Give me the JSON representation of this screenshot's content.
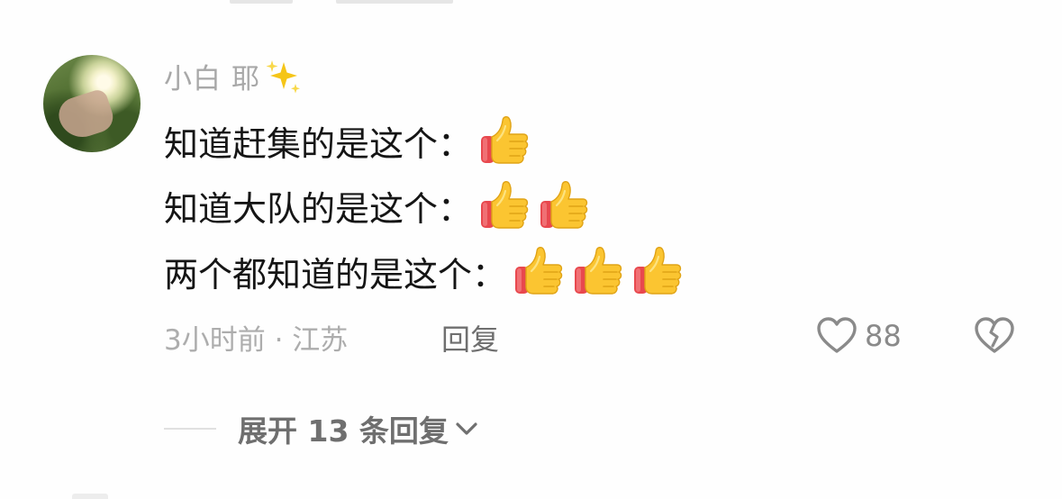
{
  "comment": {
    "username": "小白 耶",
    "username_emoji": "sparkles",
    "lines": [
      {
        "text": "知道赶集的是这个：",
        "thumbs": 1
      },
      {
        "text": "知道大队的是这个：",
        "thumbs": 2
      },
      {
        "text": "两个都知道的是这个：",
        "thumbs": 3
      }
    ],
    "meta": "3小时前 · 江苏",
    "reply_label": "回复",
    "like_count": "88"
  },
  "expand_replies": {
    "label": "展开 13 条回复"
  },
  "icons": {
    "like": "heart-outline-icon",
    "dislike": "broken-heart-icon",
    "expand": "chevron-down-icon",
    "thumb": "thumbs-up-emoji"
  },
  "colors": {
    "primary_text": "#151515",
    "secondary_text": "#a8a8a8",
    "action_text": "#6f6f6f",
    "icon_stroke": "#8a8a8a"
  }
}
